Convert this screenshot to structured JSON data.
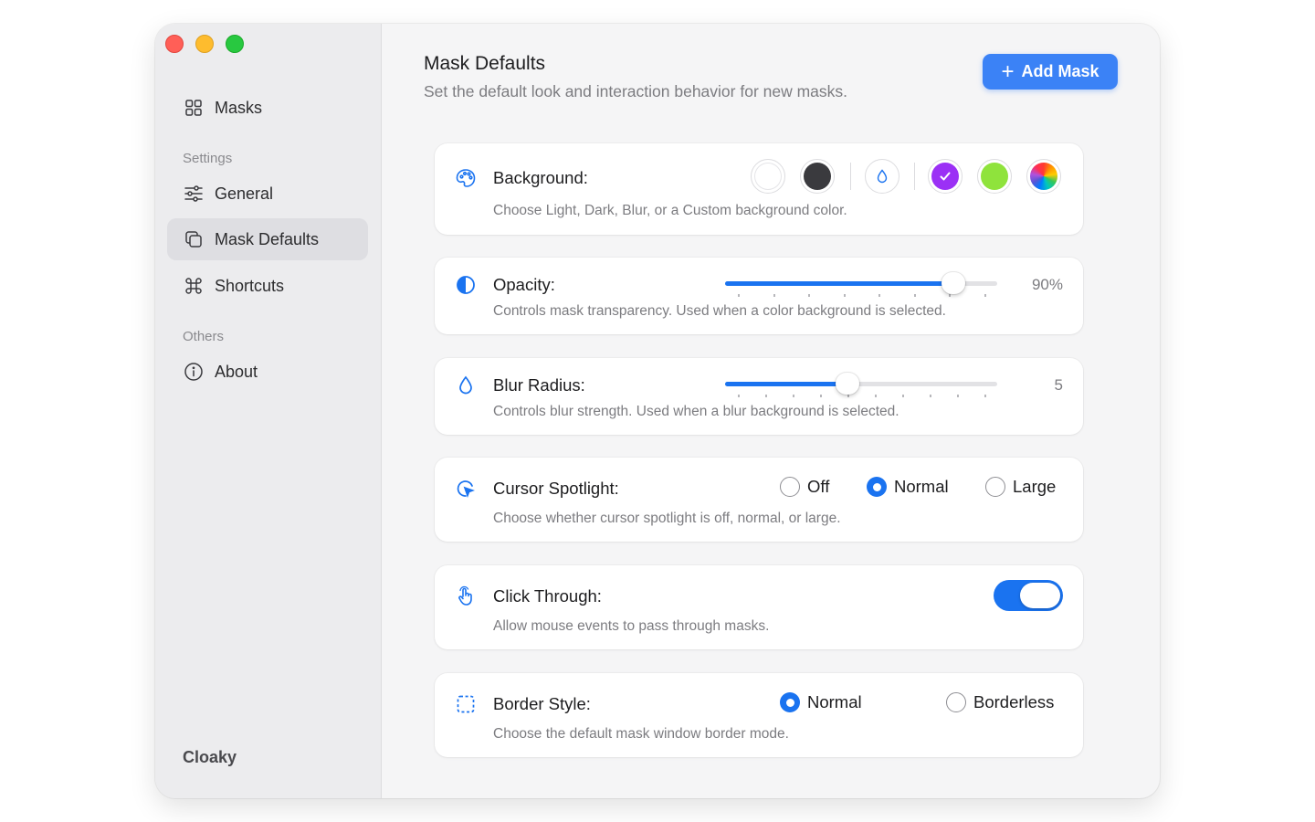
{
  "window": {
    "traffic_lights": [
      "close",
      "minimize",
      "zoom"
    ]
  },
  "sidebar": {
    "items": [
      {
        "label": "Masks",
        "icon": "grid-icon"
      },
      {
        "label": "General",
        "icon": "sliders-icon"
      },
      {
        "label": "Mask Defaults",
        "icon": "copy-icon",
        "active": true
      },
      {
        "label": "Shortcuts",
        "icon": "command-icon"
      },
      {
        "label": "About",
        "icon": "info-icon"
      }
    ],
    "sections": {
      "settings": "Settings",
      "others": "Others"
    },
    "app_name": "Cloaky"
  },
  "header": {
    "title": "Mask Defaults",
    "subtitle": "Set the default look and interaction behavior for new masks.",
    "add_button": "Add Mask"
  },
  "background": {
    "label": "Background:",
    "description": "Choose Light, Dark, Blur, or a Custom background color.",
    "swatches": [
      {
        "name": "light",
        "color": "#ffffff"
      },
      {
        "name": "dark",
        "color": "#3a3a3e"
      },
      {
        "name": "blur",
        "color": "#ffffff"
      },
      {
        "name": "purple",
        "color": "#9b30f5",
        "selected": true
      },
      {
        "name": "green",
        "color": "#8fe33c"
      },
      {
        "name": "custom",
        "color": "multicolor"
      }
    ]
  },
  "opacity": {
    "label": "Opacity:",
    "description": "Controls mask transparency. Used when a color background is selected.",
    "value_text": "90%",
    "value": 0.84,
    "tick_count": 8
  },
  "blur": {
    "label": "Blur Radius:",
    "description": "Controls blur strength. Used when a blur background is selected.",
    "value_text": "5",
    "value": 0.45,
    "tick_count": 10
  },
  "cursor_spotlight": {
    "label": "Cursor Spotlight:",
    "description": "Choose whether cursor spotlight is off, normal, or large.",
    "options": [
      "Off",
      "Normal",
      "Large"
    ],
    "selected": "Normal"
  },
  "click_through": {
    "label": "Click Through:",
    "description": "Allow mouse events to pass through masks.",
    "enabled": true
  },
  "border_style": {
    "label": "Border Style:",
    "description": "Choose the default mask window border mode.",
    "options": [
      "Normal",
      "Borderless"
    ],
    "selected": "Normal"
  },
  "colors": {
    "accent": "#1a73f0",
    "button": "#3b82f6"
  }
}
